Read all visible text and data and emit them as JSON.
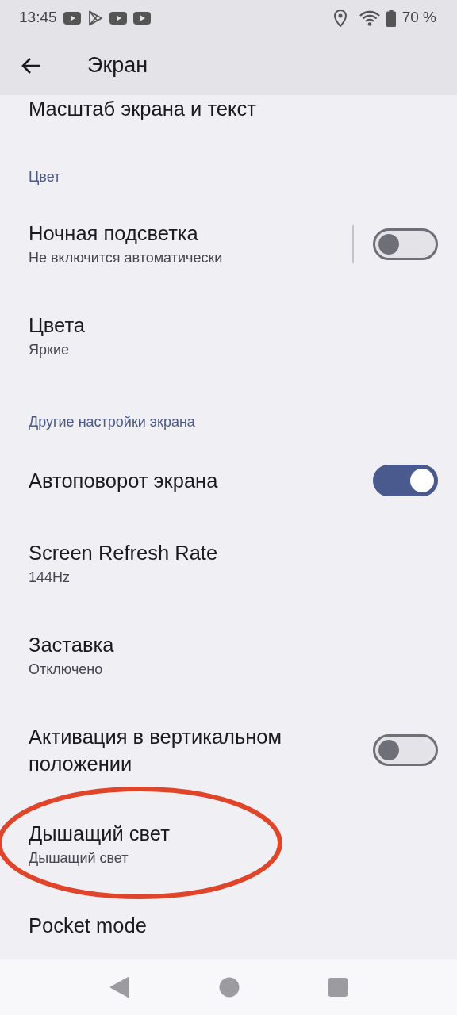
{
  "status_bar": {
    "time": "13:45",
    "notifications": [
      {
        "kind": "video"
      },
      {
        "kind": "store"
      },
      {
        "kind": "video"
      },
      {
        "kind": "video"
      }
    ],
    "battery": "70 %"
  },
  "header": {
    "title": "Экран"
  },
  "items": [
    {
      "kind": "plain",
      "title": "Масштаб экрана и текст"
    },
    {
      "kind": "section",
      "title": "Цвет"
    },
    {
      "kind": "split-toggle",
      "title": "Ночная подсветка",
      "subtitle": "Не включится автоматически",
      "on": false
    },
    {
      "kind": "plain",
      "title": "Цвета",
      "subtitle": "Яркие"
    },
    {
      "kind": "section",
      "title": "Другие настройки экрана"
    },
    {
      "kind": "toggle",
      "title": "Автоповорот экрана",
      "on": true
    },
    {
      "kind": "plain",
      "title": "Screen Refresh Rate",
      "subtitle": "144Hz"
    },
    {
      "kind": "plain",
      "title": "Заставка",
      "subtitle": "Отключено"
    },
    {
      "kind": "toggle",
      "title": "Активация в вертикальном положении",
      "on": false
    },
    {
      "kind": "plain",
      "title": "Дышащий свет",
      "subtitle": "Дышащий свет",
      "circled": true
    },
    {
      "kind": "plain",
      "title": "Pocket mode"
    }
  ]
}
